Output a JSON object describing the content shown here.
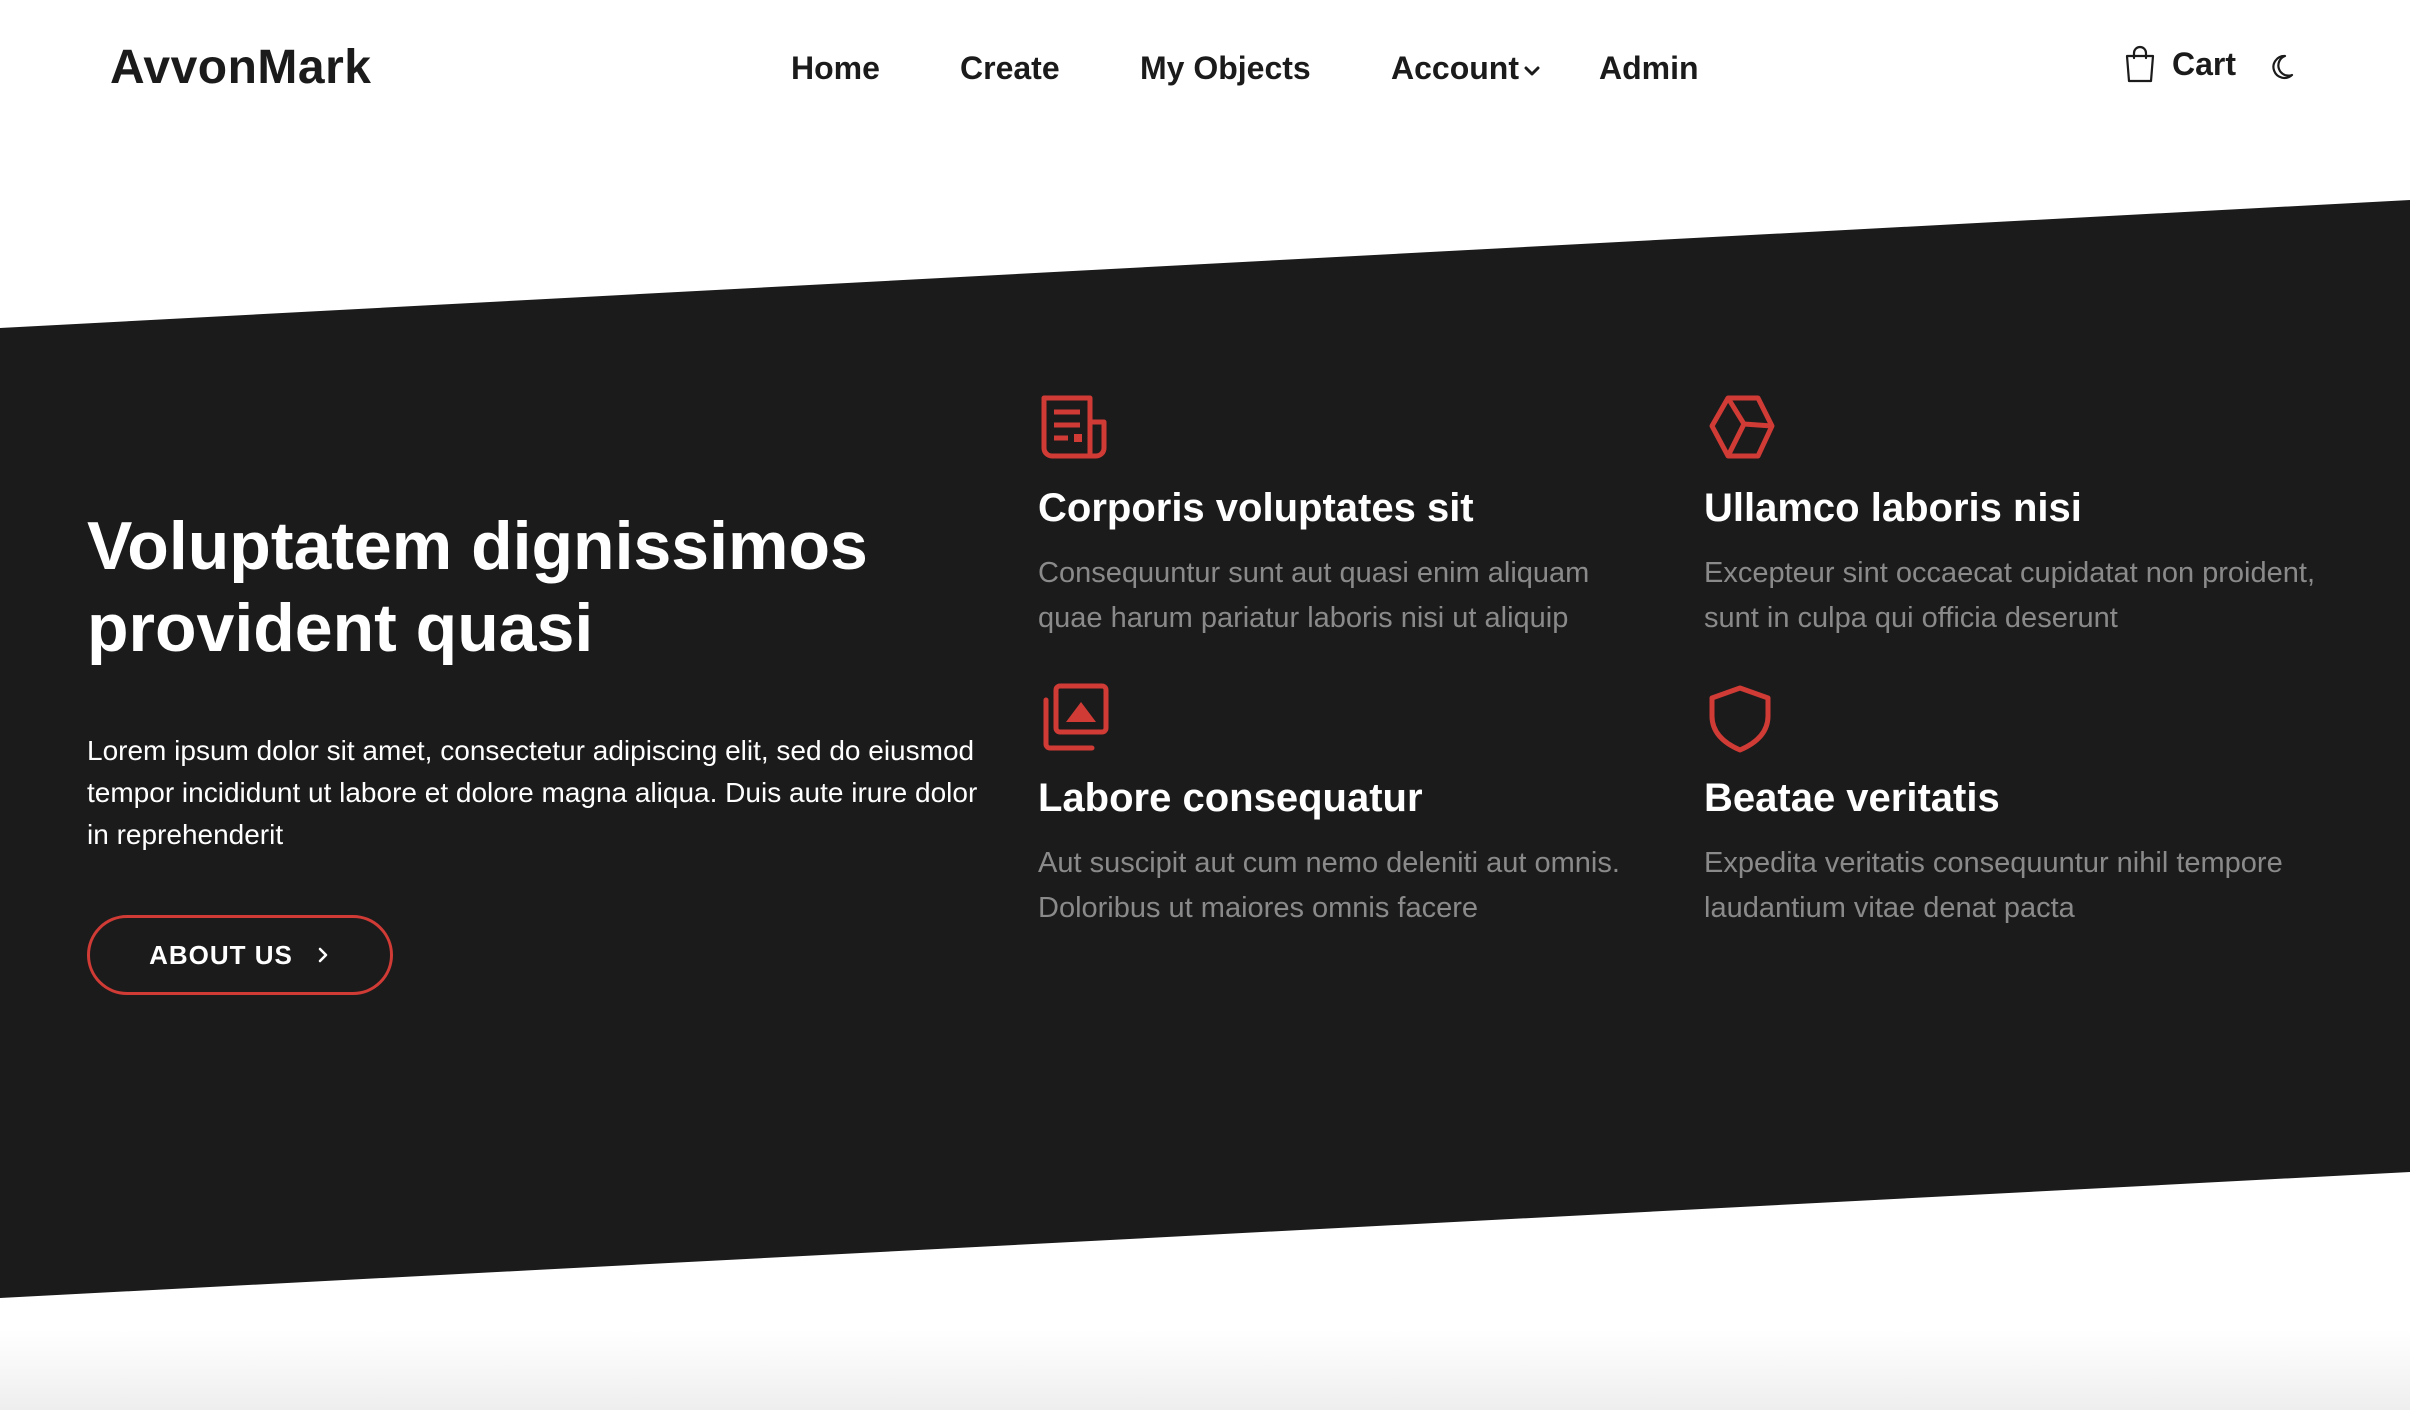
{
  "header": {
    "logo": "AvvonMark",
    "nav": {
      "home": "Home",
      "create": "Create",
      "my_objects": "My Objects",
      "account": "Account",
      "admin": "Admin"
    },
    "cart_label": "Cart",
    "icons": {
      "account_dropdown": "chevron-down-icon",
      "cart": "shopping-bag-icon",
      "theme": "moon-icon"
    }
  },
  "hero": {
    "title": "Voluptatem dignissimos provident quasi",
    "text": "Lorem ipsum dolor sit amet, consectetur adipiscing elit, sed do eiusmod tempor incididunt ut labore et dolore magna aliqua. Duis aute irure dolor in reprehenderit",
    "button_label": "ABOUT US"
  },
  "features": [
    {
      "icon": "newspaper-icon",
      "title": "Corporis voluptates sit",
      "text": "Consequuntur sunt aut quasi enim aliquam quae harum pariatur laboris nisi ut aliquip"
    },
    {
      "icon": "box-icon",
      "title": "Ullamco laboris nisi",
      "text": "Excepteur sint occaecat cupidatat non proident, sunt in culpa qui officia deserunt"
    },
    {
      "icon": "images-icon",
      "title": "Labore consequatur",
      "text": "Aut suscipit aut cum nemo deleniti aut omnis. Doloribus ut maiores omnis facere"
    },
    {
      "icon": "shield-icon",
      "title": "Beatae veritatis",
      "text": "Expedita veritatis consequuntur nihil tempore laudantium vitae denat pacta"
    }
  ],
  "colors": {
    "accent": "#d03b35",
    "band": "#1b1b1c",
    "muted_text": "#8a8a8a"
  }
}
